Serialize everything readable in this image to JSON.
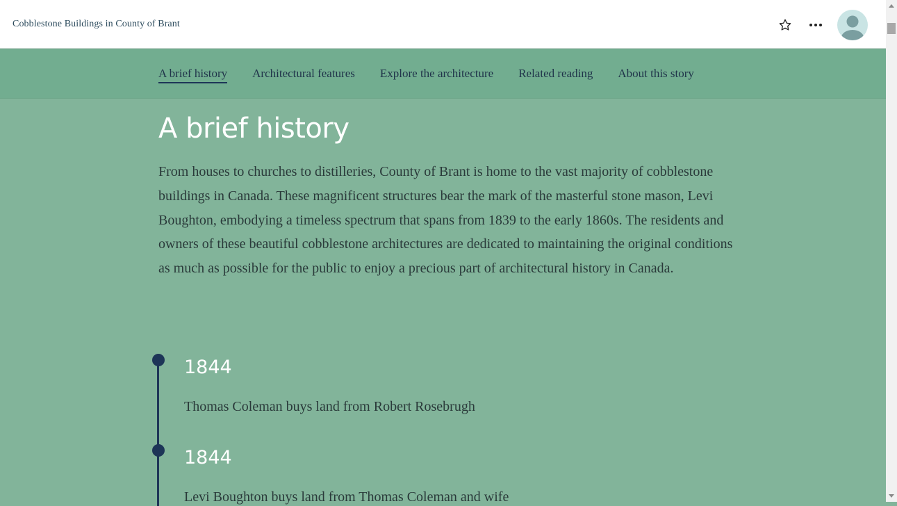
{
  "header": {
    "app_title": "Cobblestone Buildings in County of Brant",
    "icons": [
      "star-icon",
      "more-options-icon",
      "user-avatar-icon"
    ]
  },
  "nav": {
    "tabs": [
      {
        "label": "A brief history",
        "active": true
      },
      {
        "label": "Architectural features",
        "active": false
      },
      {
        "label": "Explore the architecture",
        "active": false
      },
      {
        "label": "Related reading",
        "active": false
      },
      {
        "label": "About this story",
        "active": false
      }
    ]
  },
  "main": {
    "title": "A brief history",
    "intro": "From houses to churches to distilleries, County of Brant is home to the vast majority of cobblestone buildings in Canada. These magnificent structures bear the mark of the masterful stone mason, Levi Boughton, embodying a timeless spectrum that spans from 1839 to the early 1860s. The residents and owners of these beautiful cobblestone architectures are dedicated to maintaining the original conditions as much as possible for the public to enjoy a precious part of architectural history in Canada.",
    "timeline": [
      {
        "year": "1844",
        "text": "Thomas Coleman buys land from Robert Rosebrugh"
      },
      {
        "year": "1844",
        "text": "Levi Boughton buys land from Thomas Coleman and wife"
      }
    ]
  },
  "colors": {
    "background": "#82b49a",
    "nav_background": "#72ad90",
    "accent": "#1d3557",
    "title_text": "#ffffff",
    "body_text": "#2a3a3a"
  }
}
